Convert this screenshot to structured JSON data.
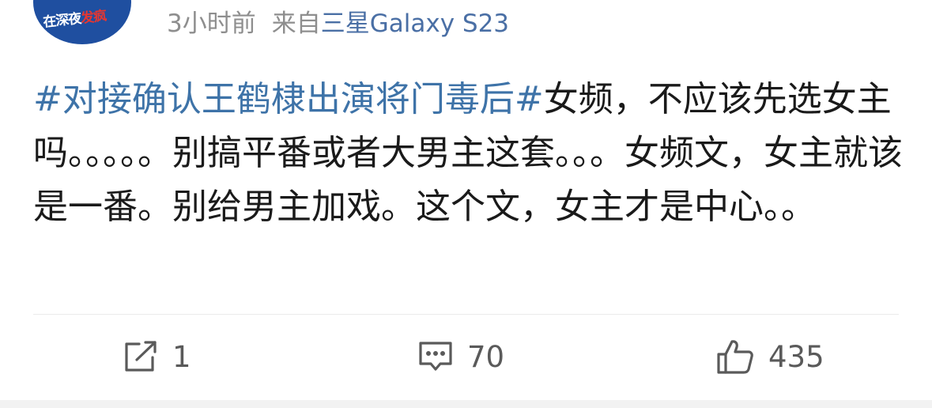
{
  "avatar": {
    "text_white": "在深夜",
    "text_red": "发疯"
  },
  "meta": {
    "time": "3小时前",
    "from_label": "来自",
    "device": "三星Galaxy S23"
  },
  "post": {
    "hashtag": "#对接确认王鹤棣出演将门毒后#",
    "body": "女频，不应该先选女主吗。。。。。别搞平番或者大男主这套。。。女频文，女主就该是一番。别给男主加戏。这个文，女主才是中心。。"
  },
  "actions": {
    "repost": {
      "icon": "repost-icon",
      "count": "1"
    },
    "comment": {
      "icon": "comment-icon",
      "count": "70"
    },
    "like": {
      "icon": "thumbs-up-icon",
      "count": "435"
    }
  },
  "colors": {
    "link": "#3e73a8",
    "meta": "#8e8e8e",
    "text": "#1a1a1a",
    "avatar_bg": "#1f4fa0"
  }
}
